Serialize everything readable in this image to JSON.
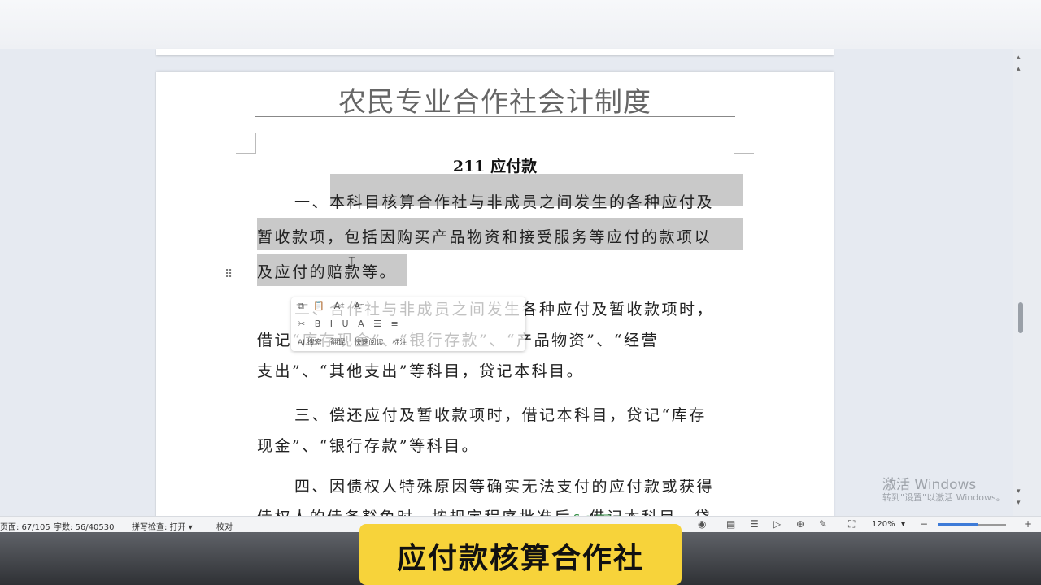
{
  "document": {
    "header_title": "农民专业合作社会计制度",
    "section_title": "211 应付款",
    "lines": [
      "一、本科目核算合作社与非成员之间发生的各种应付及",
      "暂收款项，包括因购买产品物资和接受服务等应付的款项以",
      "及应付的赔款等。",
      "二、合作社与非成员之间发生各种应付及暂收款项时，",
      "借记“库存现金”、“银行存款”、“产品物资”、“经营",
      "支出”、“其他支出”等科目，贷记本科目。",
      "三、偿还应付及暂收款项时，借记本科目，贷记“库存",
      "现金”、“银行存款”等科目。",
      "四、因债权人特殊原因等确实无法支付的应付款或获得",
      "债权人的债务豁免时，按规定程序批准后，借记本科目，贷"
    ]
  },
  "mini_toolbar": {
    "row1": [
      "⧉",
      "📋",
      "A⁺",
      "A⁻"
    ],
    "row2": [
      "✂",
      "B",
      "I",
      "U",
      "A",
      "☰",
      "≡"
    ],
    "row3": [
      "AI 搜索",
      "翻译",
      "快速阅读",
      "标注"
    ]
  },
  "statusbar": {
    "page": "页面: 67/105",
    "wordcount": "字数: 56/40530",
    "spellcheck": "拼写检查: 打开 ▾",
    "proofread": "校对",
    "zoom": "120%",
    "zoom_level": 0.6
  },
  "watermark": {
    "line1": "激活 Windows",
    "line2": "转到\"设置\"以激活 Windows。"
  },
  "subtitle": "应付款核算合作社",
  "colors": {
    "highlight": "#c9c9c9",
    "subtitle_bg": "#f7d33a",
    "accent": "#3d7bd8"
  }
}
